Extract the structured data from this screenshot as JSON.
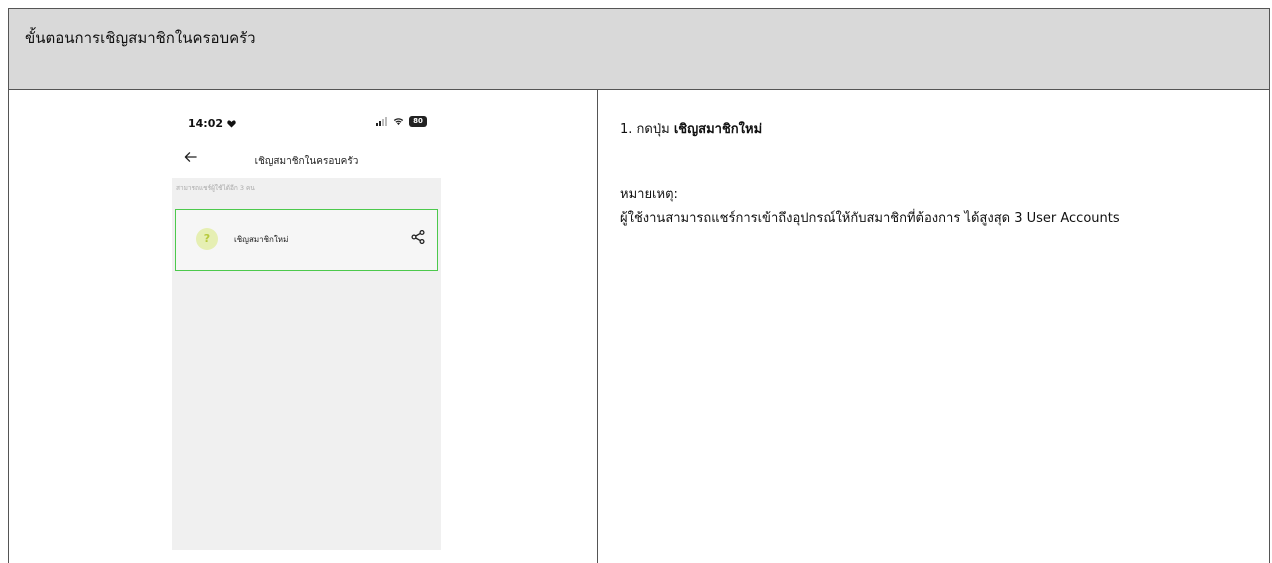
{
  "header": {
    "title": "ขั้นตอนการเชิญสมาชิกในครอบครัว"
  },
  "phone": {
    "status_time": "14:02",
    "battery_level": "80",
    "nav_title": "เชิญสมาชิกในครอบครัว",
    "share_limit_text": "สามารถแชร์ผู้ใช้ได้อีก 3 คน",
    "invite_button_label": "เชิญสมาชิกใหม่",
    "invite_icon_glyph": "?",
    "icons": [
      "heart-icon",
      "signal-icon",
      "wifi-icon",
      "battery-icon",
      "back-arrow-icon",
      "share-icon"
    ]
  },
  "instructions": {
    "step_prefix": "1. กดปุ่ม ",
    "step_bold": "เชิญสมาชิกใหม่",
    "note_label": "หมายเหตุ:",
    "note_body": "ผู้ใช้งานสามารถแชร์การเข้าถึงอุปกรณ์ให้กับสมาชิกที่ต้องการ ได้สูงสุด 3 User Accounts"
  },
  "colors": {
    "header_bg": "#d9d9d9",
    "card_border": "#4cc94c",
    "content_bg": "#f0f0f0",
    "invite_icon_bg": "#e6efb3"
  }
}
